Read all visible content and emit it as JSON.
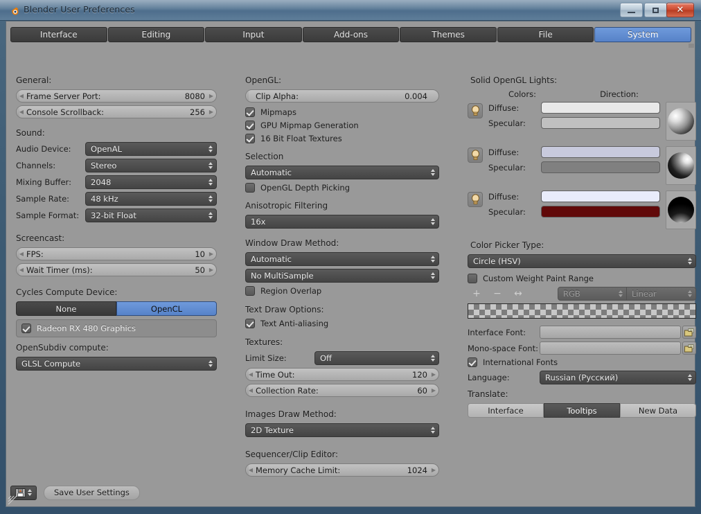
{
  "window": {
    "title": "Blender User Preferences",
    "logo_icon": "blender-logo-icon",
    "minimize_label": "",
    "maximize_label": "",
    "close_label": "✕"
  },
  "tabs": [
    {
      "label": "Interface",
      "active": false
    },
    {
      "label": "Editing",
      "active": false
    },
    {
      "label": "Input",
      "active": false
    },
    {
      "label": "Add-ons",
      "active": false
    },
    {
      "label": "Themes",
      "active": false
    },
    {
      "label": "File",
      "active": false
    },
    {
      "label": "System",
      "active": true
    }
  ],
  "left_column": {
    "general_header": "General:",
    "frame_server_port": {
      "label": "Frame Server Port:",
      "value": "8080"
    },
    "console_scrollback": {
      "label": "Console Scrollback:",
      "value": "256"
    },
    "sound_header": "Sound:",
    "audio_device": {
      "label": "Audio Device:",
      "value": "OpenAL"
    },
    "channels": {
      "label": "Channels:",
      "value": "Stereo"
    },
    "mixing_buffer": {
      "label": "Mixing Buffer:",
      "value": "2048"
    },
    "sample_rate": {
      "label": "Sample Rate:",
      "value": "48 kHz"
    },
    "sample_format": {
      "label": "Sample Format:",
      "value": "32-bit Float"
    },
    "screencast_header": "Screencast:",
    "fps": {
      "label": "FPS:",
      "value": "10"
    },
    "wait_timer": {
      "label": "Wait Timer (ms):",
      "value": "50"
    },
    "cycles_header": "Cycles Compute Device:",
    "cycles_none": "None",
    "cycles_opencl": "OpenCL",
    "gpu_device": {
      "label": "Radeon RX 480 Graphics",
      "checked": true
    },
    "opensubdiv_header": "OpenSubdiv compute:",
    "opensubdiv_value": "GLSL Compute"
  },
  "middle_column": {
    "opengl_header": "OpenGL:",
    "clip_alpha": {
      "label": "Clip Alpha:",
      "value": "0.004"
    },
    "mipmaps": {
      "label": "Mipmaps",
      "checked": true
    },
    "gpu_mipmap": {
      "label": "GPU Mipmap Generation",
      "checked": true
    },
    "float_textures": {
      "label": "16 Bit Float Textures",
      "checked": true
    },
    "selection_header": "Selection",
    "selection_value": "Automatic",
    "depth_picking": {
      "label": "OpenGL Depth Picking",
      "checked": false
    },
    "anisotropic_header": "Anisotropic Filtering",
    "anisotropic_value": "16x",
    "window_draw_header": "Window Draw Method:",
    "window_draw_value": "Automatic",
    "multisample_value": "No MultiSample",
    "region_overlap": {
      "label": "Region Overlap",
      "checked": false
    },
    "text_draw_header": "Text Draw Options:",
    "text_aa": {
      "label": "Text Anti-aliasing",
      "checked": true
    },
    "textures_header": "Textures:",
    "limit_size": {
      "label": "Limit Size:",
      "value": "Off"
    },
    "time_out": {
      "label": "Time Out:",
      "value": "120"
    },
    "collection_rate": {
      "label": "Collection Rate:",
      "value": "60"
    },
    "images_draw_header": "Images Draw Method:",
    "images_draw_value": "2D Texture",
    "sequencer_header": "Sequencer/Clip Editor:",
    "memory_cache_limit": {
      "label": "Memory Cache Limit:",
      "value": "1024"
    }
  },
  "right_column": {
    "lights_header": "Solid OpenGL Lights:",
    "colors_header": "Colors:",
    "direction_header": "Direction:",
    "diffuse_label": "Diffuse:",
    "specular_label": "Specular:",
    "lights": [
      {
        "icon": "light-bulb-icon",
        "diffuse_color": "#e8e8e8",
        "specular_color": "#c0c0c0",
        "ball_highlight": "30% 30%"
      },
      {
        "icon": "light-bulb-icon",
        "diffuse_color": "#c8cadd",
        "specular_color": "#808080",
        "ball_highlight": "72% 28%"
      },
      {
        "icon": "light-bulb-icon",
        "diffuse_color": "#e9ecfb",
        "specular_color": "#610909",
        "ball_highlight": "50% 108%"
      }
    ],
    "color_picker_header": "Color Picker Type:",
    "color_picker_value": "Circle (HSV)",
    "custom_weight_paint": {
      "label": "Custom Weight Paint Range",
      "checked": false
    },
    "ramp_tools": {
      "add": "+",
      "remove": "−",
      "flip": "↔"
    },
    "ramp_color_mode": "RGB",
    "ramp_interpolation": "Linear",
    "interface_font": {
      "label": "Interface Font:",
      "value": "",
      "browse_icon": "folder-icon"
    },
    "mono_font": {
      "label": "Mono-space Font:",
      "value": "",
      "browse_icon": "folder-icon"
    },
    "international_fonts": {
      "label": "International Fonts",
      "checked": true
    },
    "language": {
      "label": "Language:",
      "value": "Russian (Русский)"
    },
    "translate_header": "Translate:",
    "translate_buttons": [
      {
        "label": "Interface",
        "active": false
      },
      {
        "label": "Tooltips",
        "active": true
      },
      {
        "label": "New Data",
        "active": false
      }
    ]
  },
  "footer": {
    "preset_icon": "save-preset-icon",
    "save_button": "Save User Settings"
  },
  "colors": {
    "accent_blue": "#5682c8",
    "panel_bg": "#999999",
    "widget_dark": "#444444",
    "widget_light": "#b5b5b5"
  }
}
